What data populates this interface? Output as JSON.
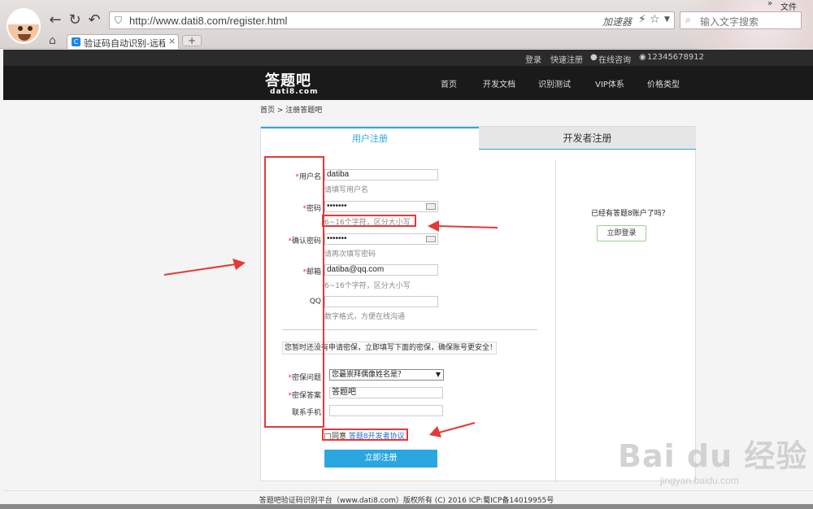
{
  "browser": {
    "url": "http://www.dati8.com/register.html",
    "accelerator": "加速器",
    "search_placeholder": "输入文字搜索",
    "menu_file": "文件",
    "more": "»",
    "tab_title": "验证码自动识别-远程打码",
    "tab_close": "×",
    "new_tab": "+"
  },
  "topbar": {
    "login": "登录",
    "register": "快速注册",
    "online": "在线咨询",
    "phone": "12345678912"
  },
  "header": {
    "logo": "答题吧",
    "logo_sub": "dati8.com",
    "menu": [
      "首页",
      "开发文档",
      "识别测试",
      "VIP体系",
      "价格类型"
    ]
  },
  "breadcrumb": "首页 > 注册答题吧",
  "tabs": {
    "user": "用户注册",
    "developer": "开发者注册"
  },
  "form": {
    "username": {
      "label": "用户名",
      "value": "datiba",
      "hint": "请填写用户名"
    },
    "password": {
      "label": "密码",
      "value": "•••••••",
      "hint": "6~16个字符，区分大小写"
    },
    "confirm": {
      "label": "确认密码",
      "value": "•••••••",
      "hint": "请再次填写密码"
    },
    "email": {
      "label": "邮箱",
      "value": "datiba@qq.com",
      "hint": "6~16个字符，区分大小写"
    },
    "qq": {
      "label": "QQ",
      "value": "",
      "hint": "数字格式，方便在线沟通"
    },
    "notice": "您暂时还没有申请密保，立即填写下面的密保，确保账号更安全！",
    "security_question": {
      "label": "密保问题",
      "value": "您最崇拜偶像姓名是？"
    },
    "security_answer": {
      "label": "密保答案",
      "value": "答题吧"
    },
    "phone": {
      "label": "联系手机",
      "value": ""
    },
    "agree_text": "同意",
    "agree_link": "答题8开发者协议",
    "submit": "立即注册",
    "required_mark": "*"
  },
  "side": {
    "question": "已经有答题8账户了吗？",
    "login_button": "立即登录"
  },
  "footer": "答题吧验证码识别平台（www.dati8.com）版权所有 (C) 2016 ICP:蜀ICP备14019955号",
  "watermark": {
    "text": "Bai du 经验",
    "sub": "jingyan.baidu.com"
  },
  "annotation_color": "#e53935",
  "accent_color": "#2aa7e0"
}
